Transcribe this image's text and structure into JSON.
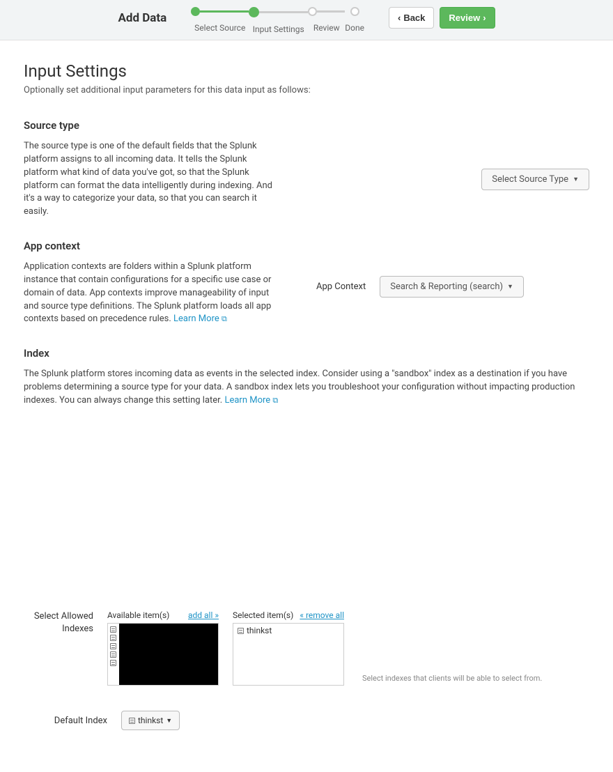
{
  "header": {
    "title": "Add Data",
    "steps": [
      {
        "label": "Select Source",
        "state": "done"
      },
      {
        "label": "Input Settings",
        "state": "current"
      },
      {
        "label": "Review",
        "state": "future"
      },
      {
        "label": "Done",
        "state": "future"
      }
    ],
    "back_label": "Back",
    "review_label": "Review"
  },
  "page": {
    "title": "Input Settings",
    "description": "Optionally set additional input parameters for this data input as follows:"
  },
  "source_type": {
    "heading": "Source type",
    "body": "The source type is one of the default fields that the Splunk platform assigns to all incoming data. It tells the Splunk platform what kind of data you've got, so that the Splunk platform can format the data intelligently during indexing. And it's a way to categorize your data, so that you can search it easily.",
    "dropdown_label": "Select Source Type"
  },
  "app_context": {
    "heading": "App context",
    "body": "Application contexts are folders within a Splunk platform instance that contain configurations for a specific use case or domain of data. App contexts improve manageability of input and source type definitions. The Splunk platform loads all app contexts based on precedence rules. ",
    "learn_more": "Learn More",
    "field_label": "App Context",
    "dropdown_label": "Search & Reporting (search)"
  },
  "index": {
    "heading": "Index",
    "body": "The Splunk platform stores incoming data as events in the selected index. Consider using a \"sandbox\" index as a destination if you have problems determining a source type for your data. A sandbox index lets you troubleshoot your configuration without impacting production indexes. You can always change this setting later. ",
    "learn_more": "Learn More",
    "select_allowed_label": "Select Allowed Indexes",
    "available_label": "Available item(s)",
    "add_all_label": "add all »",
    "selected_label": "Selected item(s)",
    "remove_all_label": "« remove all",
    "selected_items": [
      "thinkst"
    ],
    "hint": "Select indexes that clients will be able to select from.",
    "default_index_label": "Default Index",
    "default_index_value": "thinkst"
  }
}
